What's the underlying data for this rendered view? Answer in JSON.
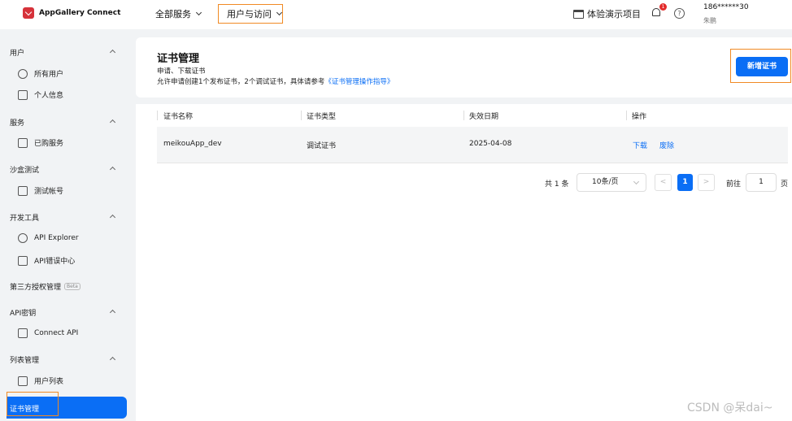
{
  "topbar": {
    "logo_text": "AppGallery Connect",
    "nav_all": "全部服务",
    "nav_user": "用户与访问",
    "demo": "体验演示项目",
    "bell_badge": "1",
    "help": "?",
    "user_id": "186******30",
    "user_name": "朱鹏"
  },
  "sidebar": {
    "sections": [
      {
        "label": "用户",
        "items": [
          "所有用户",
          "个人信息"
        ]
      },
      {
        "label": "服务",
        "items": [
          "已购服务"
        ]
      },
      {
        "label": "沙盒测试",
        "items": [
          "测试帐号"
        ]
      },
      {
        "label": "开发工具",
        "items": [
          "API Explorer",
          "API错误中心"
        ]
      },
      {
        "label": "第三方授权管理",
        "badge": "Beta"
      },
      {
        "label": "API密钥",
        "items": [
          "Connect API"
        ]
      },
      {
        "label": "列表管理",
        "items": [
          "用户列表"
        ]
      }
    ],
    "active": "证书管理"
  },
  "main": {
    "title": "证书管理",
    "desc1": "申请、下载证书",
    "desc2_prefix": "允许申请创建1个发布证书，2个调试证书，具体请参考",
    "desc2_link": "《证书管理操作指导》",
    "new_button": "新增证书"
  },
  "table": {
    "headers": [
      "证书名称",
      "证书类型",
      "失效日期",
      "操作"
    ],
    "rows": [
      {
        "name": "meikouApp_dev",
        "type": "调试证书",
        "expiry": "2025-04-08",
        "download": "下载",
        "revoke": "废除"
      }
    ]
  },
  "pagination": {
    "total": "共 1 条",
    "page_size": "10条/页",
    "prev": "<",
    "current": "1",
    "next": ">",
    "goto_label": "前往",
    "goto_value": "1",
    "page_unit": "页"
  },
  "watermark": "CSDN @呆dai~"
}
